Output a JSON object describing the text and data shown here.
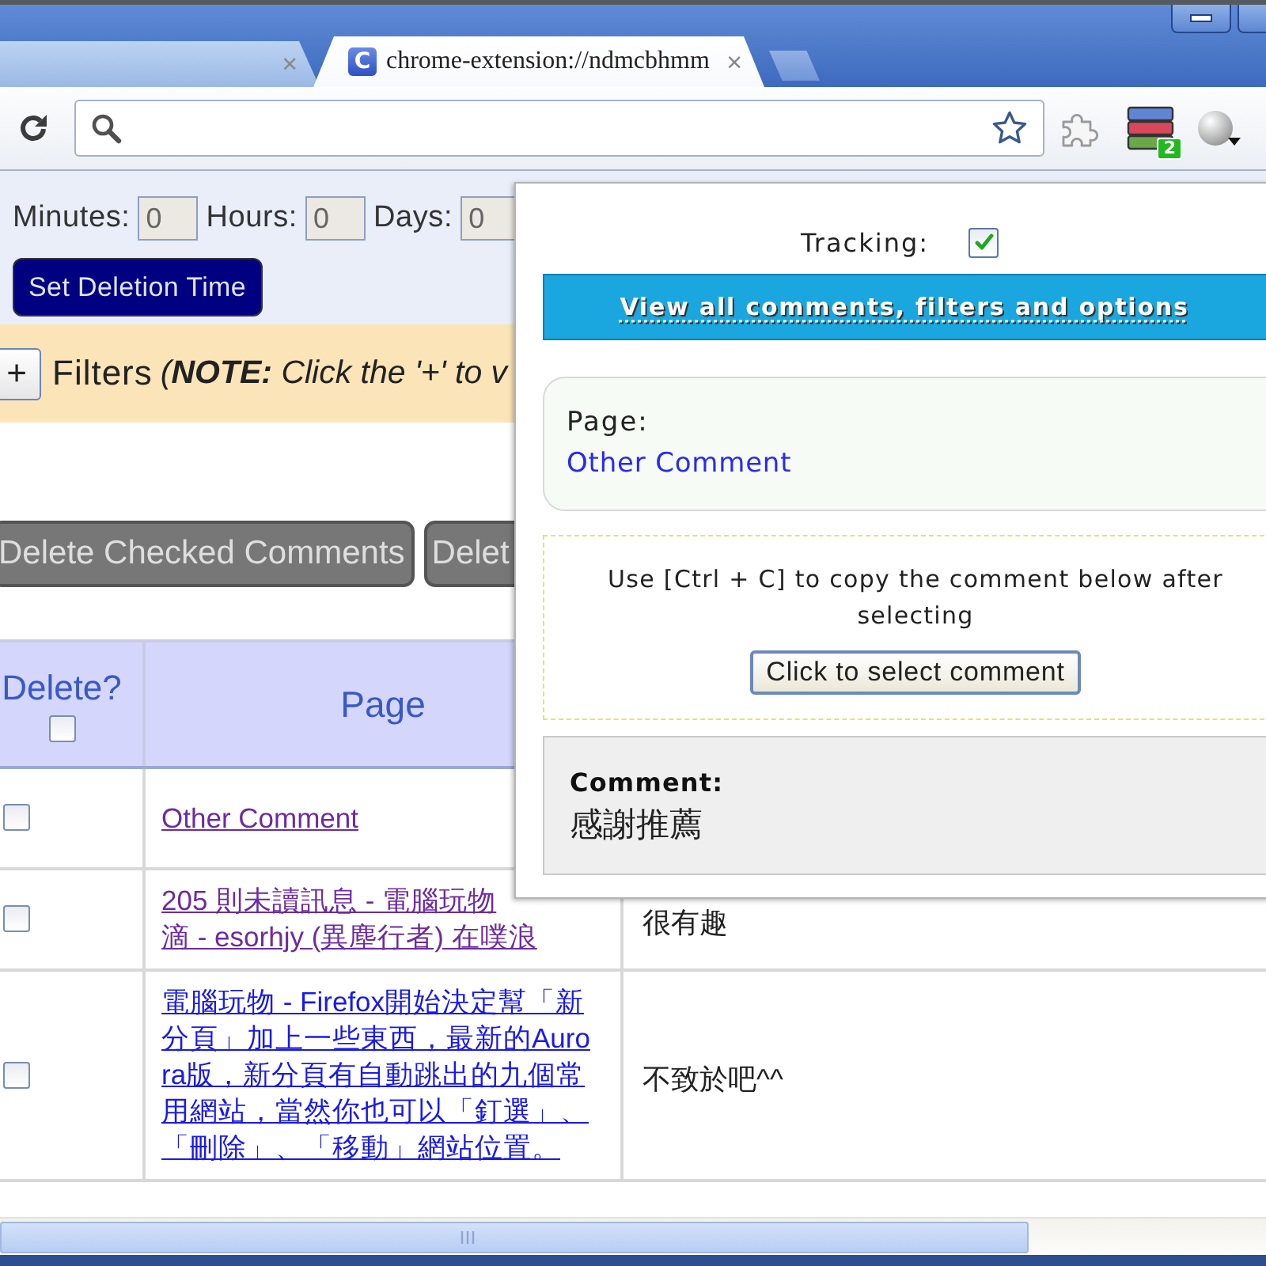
{
  "window": {
    "tabs": [
      {
        "close": "×",
        "selected": false
      },
      {
        "favicon": "C",
        "title": "chrome-extension://ndmcbhmm",
        "close": "×",
        "selected": true
      }
    ],
    "extension_badge": "2"
  },
  "deletion_time": {
    "fields": [
      {
        "label": "Minutes:",
        "value": "0"
      },
      {
        "label": "Hours:",
        "value": "0"
      },
      {
        "label": "Days:",
        "value": "0"
      }
    ],
    "button": "Set Deletion Time"
  },
  "filters": {
    "toggle": "+",
    "label": "Filters",
    "note": "(**NOTE:** Click the '+' to v"
  },
  "actions": [
    "Delete Checked Comments",
    "Delet"
  ],
  "table": {
    "columns": [
      {
        "label": "Delete?",
        "kind": "checkbox",
        "checked": false
      },
      {
        "label": "Page",
        "kind": "text"
      }
    ],
    "rows": [
      {
        "checked": false,
        "page": {
          "lines": [
            "Other Comment"
          ],
          "visited": true
        }
      },
      {
        "checked": false,
        "page": {
          "lines": [
            "205 則未讀訊息 - 電腦玩物",
            "滴 - esorhjy (異塵行者) 在噗浪"
          ],
          "visited": true
        },
        "column_3": "很有趣"
      },
      {
        "checked": false,
        "page": {
          "lines": [
            "電腦玩物 - Firefox開始決定幫「新",
            "分頁」加上一些東西，最新的Auro",
            "ra版，新分頁有自動跳出的九個常",
            "用網站，當然你也可以「釘選」、",
            "「刪除」、「移動」網站位置。"
          ],
          "visited": false
        },
        "column_3": "不致於吧^^"
      }
    ]
  },
  "popup": {
    "tracking": {
      "label": "Tracking:",
      "checked": true
    },
    "view_all": "View all comments, filters and options",
    "page": {
      "label": "Page:",
      "link": "Other Comment"
    },
    "copy": {
      "instructions": "Use [Ctrl + C] to copy the comment below after selecting",
      "button": "Click to select comment"
    },
    "comment": {
      "label": "Comment:",
      "text": "感謝推薦"
    }
  }
}
